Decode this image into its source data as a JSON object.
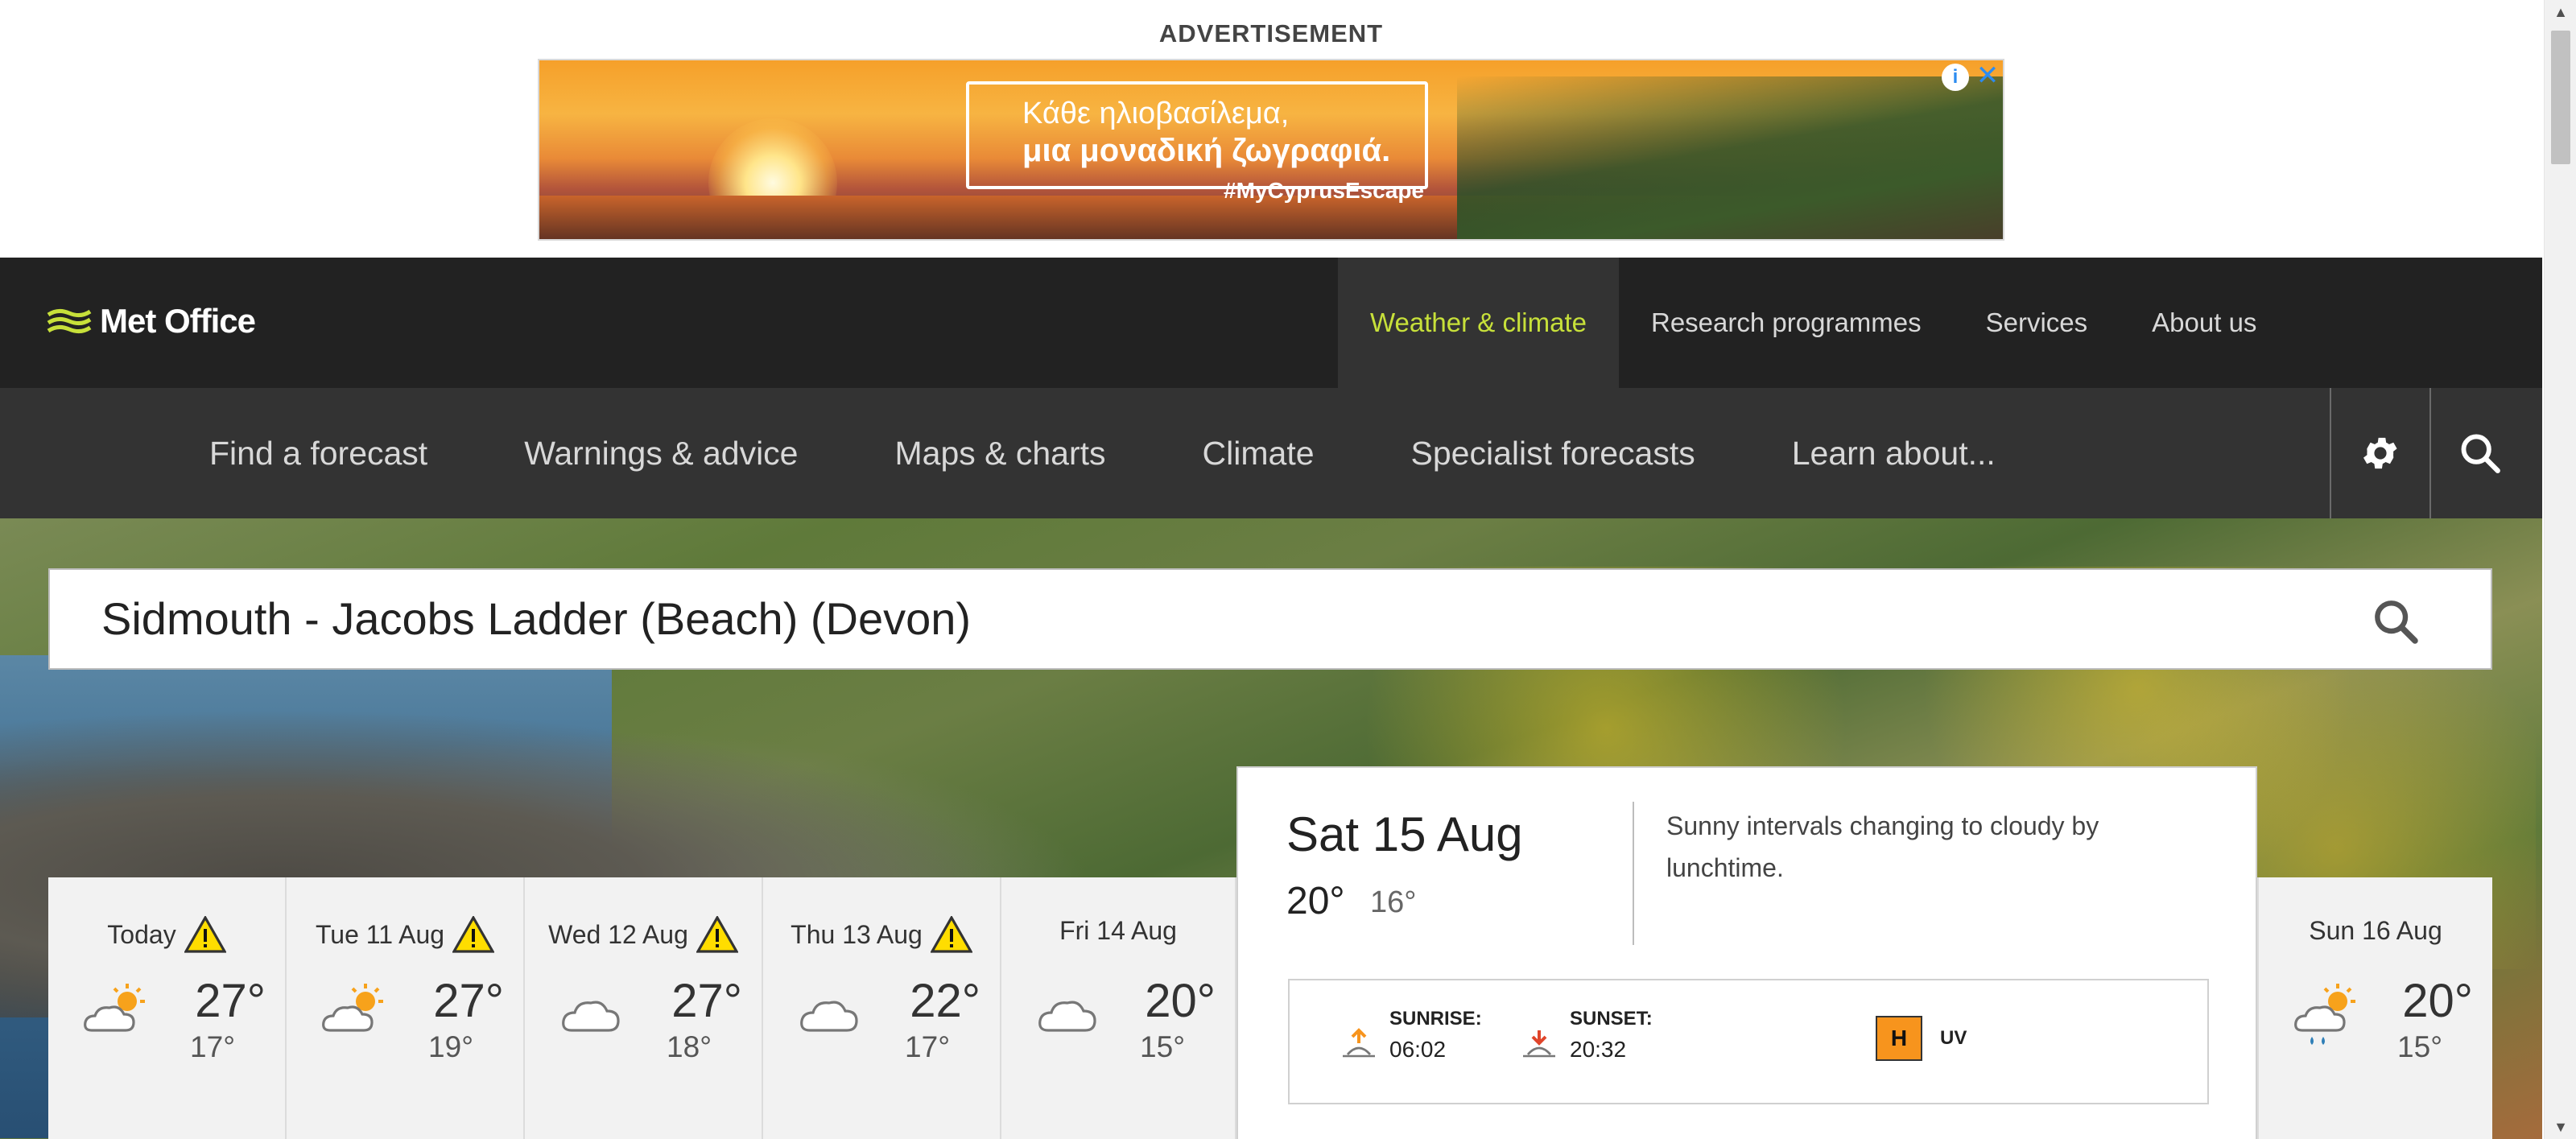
{
  "advertisement": {
    "label": "ADVERTISEMENT",
    "headline_line1": "Κάθε ηλιοβασίλεμα,",
    "headline_line2": "μια μοναδική ζωγραφιά.",
    "hashtag": "#MyCyprusEscape",
    "info_icon": "info-icon",
    "close_icon": "close-icon"
  },
  "header": {
    "logo_text": "Met Office",
    "top_nav": [
      {
        "label": "Weather & climate",
        "active": true
      },
      {
        "label": "Research programmes",
        "active": false
      },
      {
        "label": "Services",
        "active": false
      },
      {
        "label": "About us",
        "active": false
      }
    ],
    "secondary_nav": [
      {
        "label": "Find a forecast"
      },
      {
        "label": "Warnings & advice"
      },
      {
        "label": "Maps & charts"
      },
      {
        "label": "Climate"
      },
      {
        "label": "Specialist forecasts"
      },
      {
        "label": "Learn about..."
      }
    ],
    "settings_icon": "gear-icon",
    "search_icon": "search-icon"
  },
  "location_search": {
    "value": "Sidmouth - Jacobs Ladder (Beach) (Devon)"
  },
  "days": [
    {
      "label": "Today",
      "warning": true,
      "icon": "sunny-intervals-icon",
      "high": "27°",
      "low": "17°"
    },
    {
      "label": "Tue 11 Aug",
      "warning": true,
      "icon": "sunny-intervals-icon",
      "high": "27°",
      "low": "19°"
    },
    {
      "label": "Wed 12 Aug",
      "warning": true,
      "icon": "cloudy-icon",
      "high": "27°",
      "low": "18°"
    },
    {
      "label": "Thu 13 Aug",
      "warning": true,
      "icon": "cloudy-icon",
      "high": "22°",
      "low": "17°"
    },
    {
      "label": "Fri 14 Aug",
      "warning": false,
      "icon": "cloudy-icon",
      "high": "20°",
      "low": "15°"
    }
  ],
  "selected_day": {
    "date": "Sat 15 Aug",
    "high": "20°",
    "low": "16°",
    "description": "Sunny intervals changing to cloudy by lunchtime.",
    "sunrise_label": "SUNRISE:",
    "sunrise_time": "06:02",
    "sunset_label": "SUNSET:",
    "sunset_time": "20:32",
    "uv_value": "H",
    "uv_label": "UV"
  },
  "next_day": {
    "label": "Sun 16 Aug",
    "icon": "sunny-intervals-light-rain-icon",
    "high": "20°",
    "low": "15°"
  },
  "colors": {
    "brand_green": "#c7e03a",
    "header_dark": "#222222",
    "nav_dark": "#333333",
    "uv_orange": "#f7941d",
    "warning_yellow": "#ffdd00"
  }
}
